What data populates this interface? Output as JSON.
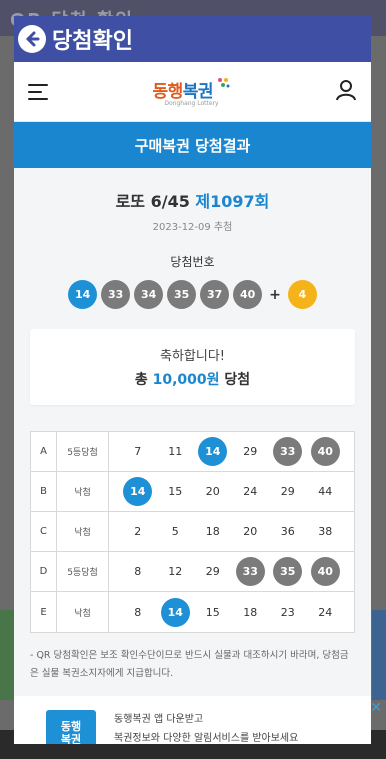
{
  "background": {
    "title": "QR 당첨 확인"
  },
  "modal": {
    "title": "당첨확인"
  },
  "site": {
    "logo_main_a": "동행",
    "logo_main_b": "복권",
    "logo_sub": "Donghang Lottery"
  },
  "section_banner": "구매복권 당첨결과",
  "draw": {
    "game": "로또 6/45",
    "round": "제1097회",
    "date": "2023-12-09 추첨",
    "winning_label": "당첨번호",
    "numbers": [
      "14",
      "33",
      "34",
      "35",
      "37",
      "40"
    ],
    "plus": "+",
    "bonus": "4"
  },
  "result": {
    "congrats": "축하합니다!",
    "prize_prefix": "총",
    "prize_amount": "10,000원",
    "prize_suffix": "당첨"
  },
  "tickets": [
    {
      "label": "A",
      "result": "5등당첨",
      "numbers": [
        {
          "n": "7",
          "m": ""
        },
        {
          "n": "11",
          "m": ""
        },
        {
          "n": "14",
          "m": "blue"
        },
        {
          "n": "29",
          "m": ""
        },
        {
          "n": "33",
          "m": "gray"
        },
        {
          "n": "40",
          "m": "gray"
        }
      ]
    },
    {
      "label": "B",
      "result": "낙첨",
      "numbers": [
        {
          "n": "14",
          "m": "blue"
        },
        {
          "n": "15",
          "m": ""
        },
        {
          "n": "20",
          "m": ""
        },
        {
          "n": "24",
          "m": ""
        },
        {
          "n": "29",
          "m": ""
        },
        {
          "n": "44",
          "m": ""
        }
      ]
    },
    {
      "label": "C",
      "result": "낙첨",
      "numbers": [
        {
          "n": "2",
          "m": ""
        },
        {
          "n": "5",
          "m": ""
        },
        {
          "n": "18",
          "m": ""
        },
        {
          "n": "20",
          "m": ""
        },
        {
          "n": "36",
          "m": ""
        },
        {
          "n": "38",
          "m": ""
        }
      ]
    },
    {
      "label": "D",
      "result": "5등당첨",
      "numbers": [
        {
          "n": "8",
          "m": ""
        },
        {
          "n": "12",
          "m": ""
        },
        {
          "n": "29",
          "m": ""
        },
        {
          "n": "33",
          "m": "gray"
        },
        {
          "n": "35",
          "m": "gray"
        },
        {
          "n": "40",
          "m": "gray"
        }
      ]
    },
    {
      "label": "E",
      "result": "낙첨",
      "numbers": [
        {
          "n": "8",
          "m": ""
        },
        {
          "n": "14",
          "m": "blue"
        },
        {
          "n": "15",
          "m": ""
        },
        {
          "n": "18",
          "m": ""
        },
        {
          "n": "23",
          "m": ""
        },
        {
          "n": "24",
          "m": ""
        }
      ]
    }
  ],
  "notice": "- QR 당첨확인은 보조 확인수단이므로 반드시 실물과 대조하시기 바라며, 당첨금은 실물 복권소지자에게 지급합니다.",
  "app_banner": {
    "icon_text_a": "동행",
    "icon_text_b": "복권",
    "line1": "동행복권 앱 다운받고",
    "line2": "복권정보와 다양한 알림서비스를 받아보세요"
  },
  "ad_close": "✕",
  "colors": {
    "header": "#3f4fa3",
    "accent": "#1a86cf",
    "gray_ball": "#7b7b7b",
    "bonus_ball": "#f5b31a"
  }
}
